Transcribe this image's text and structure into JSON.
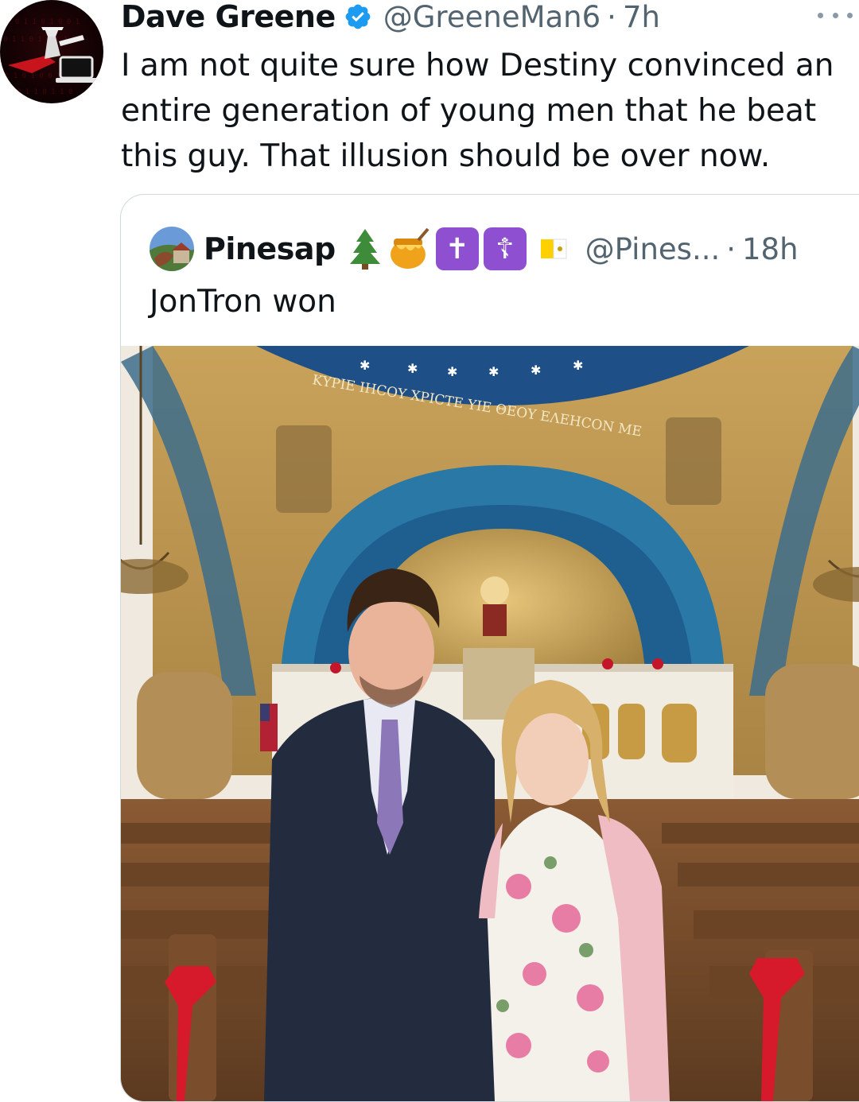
{
  "tweet": {
    "author_name": "Dave Greene",
    "author_handle": "@GreeneMan6",
    "separator": "·",
    "time": "7h",
    "text": "I am not quite sure how Destiny convinced an entire generation of young men that he beat this guy. That illusion should be over now.",
    "verified": true,
    "avatar_icon": "masked-figure-laptop-avatar",
    "more_icon": "more-dots-icon",
    "accent_color": "#1d9bf0"
  },
  "quoted_tweet": {
    "author_name": "Pinesap",
    "name_emojis": [
      "evergreen-tree-icon",
      "honey-pot-icon",
      "latin-cross-icon",
      "orthodox-cross-icon",
      "vatican-flag-icon"
    ],
    "author_handle": "@Pines...",
    "separator": "·",
    "time": "18h",
    "text": "JonTron won",
    "photo_inscription": "ΚΥΡΙΕ ΙΗϹΟΥ ΧΡΙϹΤΕ ΥΙΕ ΘΕΟΥ ΕΛΕΗϹΟΝ ΜΕ"
  }
}
